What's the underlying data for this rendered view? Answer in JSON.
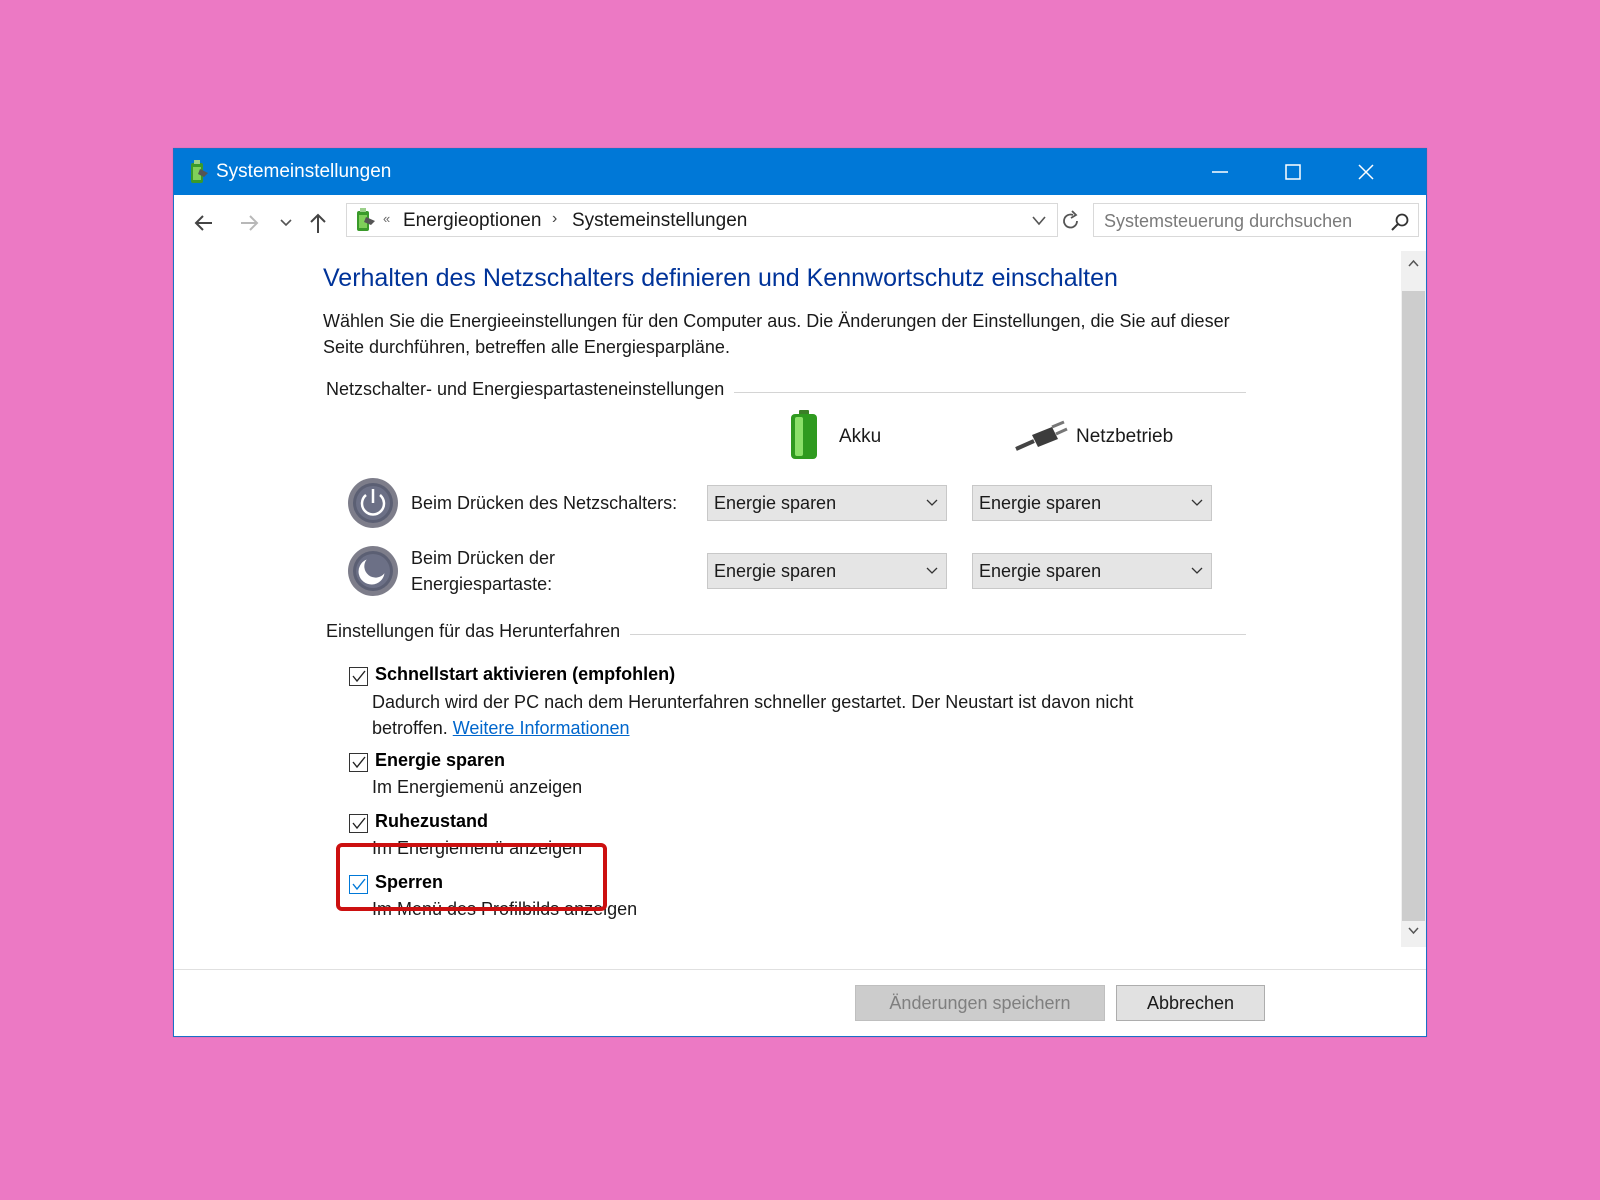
{
  "window": {
    "title": "Systemeinstellungen",
    "controls": {
      "minimize": "minimize-icon",
      "maximize": "maximize-icon",
      "close": "close-icon"
    }
  },
  "navigation": {
    "address_separator": "«",
    "breadcrumbs": [
      "Energieoptionen",
      "Systemeinstellungen"
    ],
    "search_placeholder": "Systemsteuerung durchsuchen"
  },
  "page": {
    "heading": "Verhalten des Netzschalters definieren und Kennwortschutz einschalten",
    "intro": "Wählen Sie die Energieeinstellungen für den Computer aus. Die Änderungen der Einstellungen, die Sie auf dieser Seite durchführen, betreffen alle Energiesparpläne."
  },
  "power_buttons": {
    "section_label": "Netzschalter- und Energiespartasteneinstellungen",
    "columns": {
      "battery": "Akku",
      "plugged": "Netzbetrieb"
    },
    "rows": [
      {
        "label": "Beim Drücken des Netzschalters:",
        "battery": "Energie sparen",
        "plugged": "Energie sparen"
      },
      {
        "label": "Beim Drücken der Energiespartaste:",
        "battery": "Energie sparen",
        "plugged": "Energie sparen"
      }
    ]
  },
  "shutdown": {
    "section_label": "Einstellungen für das Herunterfahren",
    "items": [
      {
        "title": "Schnellstart aktivieren (empfohlen)",
        "checked": true,
        "desc": "Dadurch wird der PC nach dem Herunterfahren schneller gestartet. Der Neustart ist davon nicht betroffen.",
        "link": "Weitere Informationen"
      },
      {
        "title": "Energie sparen",
        "checked": true,
        "desc": "Im Energiemenü anzeigen"
      },
      {
        "title": "Ruhezustand",
        "checked": true,
        "desc": "Im Energiemenü anzeigen"
      },
      {
        "title": "Sperren",
        "checked": true,
        "desc": "Im Menü des Profilbilds anzeigen"
      }
    ]
  },
  "footer": {
    "save_label": "Änderungen speichern",
    "cancel_label": "Abbrechen"
  },
  "colors": {
    "background": "#ec79c4",
    "titlebar": "#0078d7",
    "heading": "#003399",
    "link": "#0066cc",
    "highlight": "#cc1010"
  }
}
